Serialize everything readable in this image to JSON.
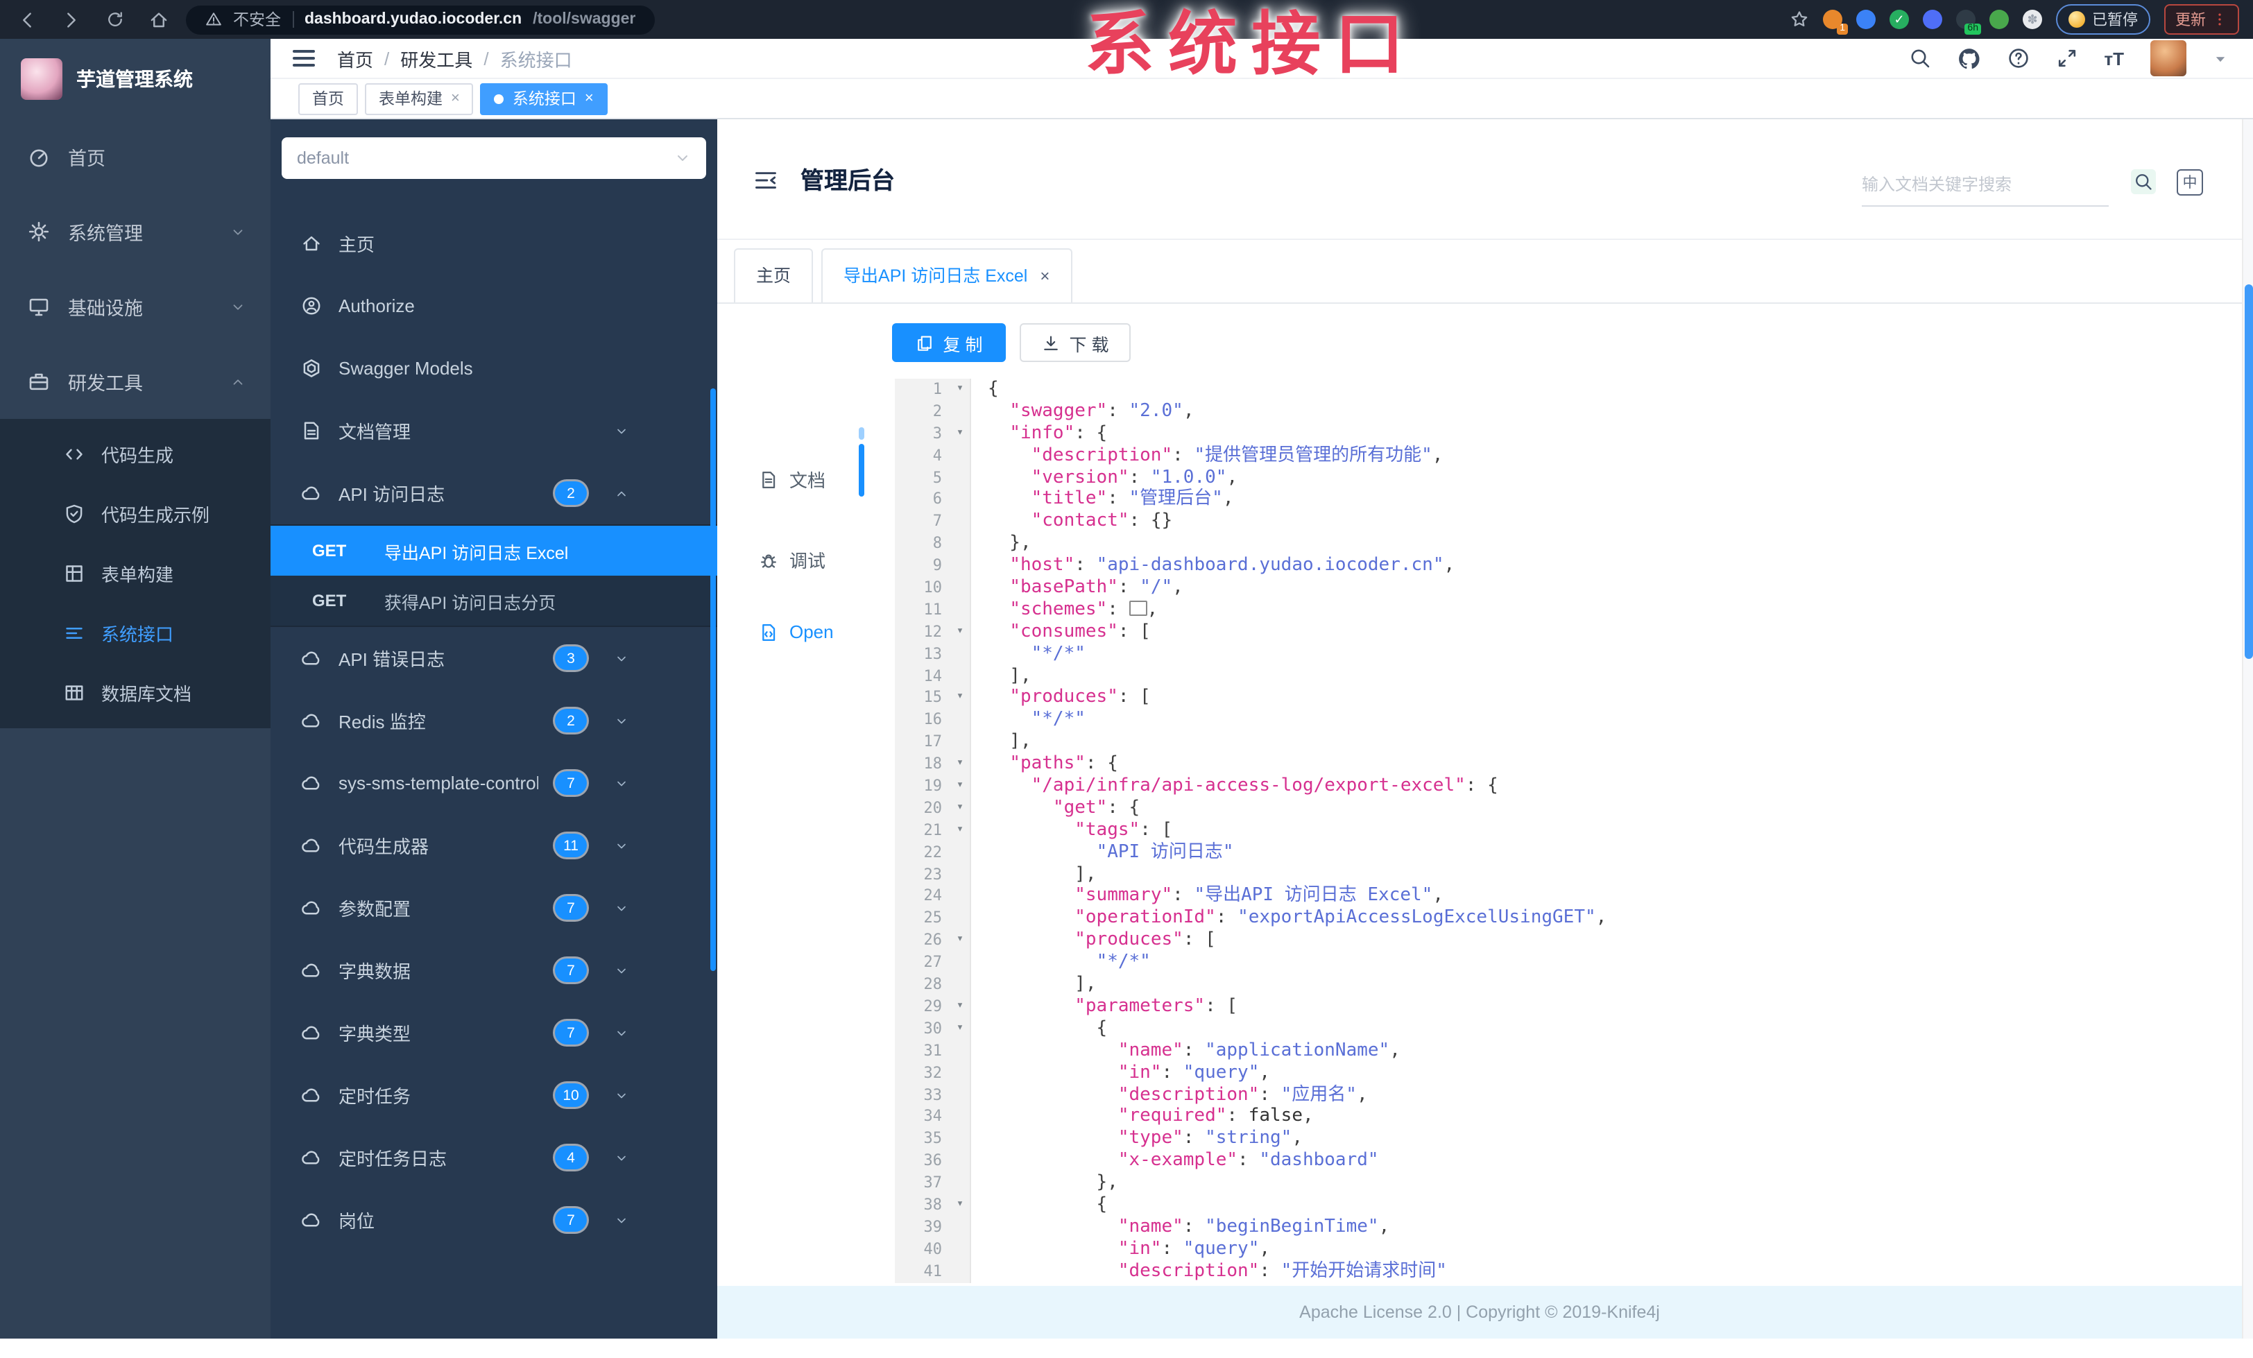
{
  "watermark": {
    "text": "系统接口"
  },
  "browser": {
    "security_label": "不安全",
    "url_host": "dashboard.yudao.iocoder.cn",
    "url_path": "/tool/swagger",
    "ext_badge_1": "1",
    "ext_badge_6h": "6h",
    "paused_label": "已暂停",
    "update_label": "更新"
  },
  "sidebar": {
    "title": "芋道管理系统",
    "menu": [
      {
        "name": "home",
        "icon": "gauge",
        "label": "首页"
      },
      {
        "name": "system-mgmt",
        "icon": "gear",
        "label": "系统管理",
        "chevron": "down"
      },
      {
        "name": "infrastructure",
        "icon": "monitor",
        "label": "基础设施",
        "chevron": "down"
      },
      {
        "name": "dev-tools",
        "icon": "briefcase",
        "label": "研发工具",
        "chevron": "up"
      }
    ],
    "submenu": [
      {
        "name": "code-gen",
        "icon": "code",
        "label": "代码生成"
      },
      {
        "name": "code-gen-example",
        "icon": "shield",
        "label": "代码生成示例"
      },
      {
        "name": "form-builder",
        "icon": "grid",
        "label": "表单构建"
      },
      {
        "name": "system-api",
        "icon": "api",
        "label": "系统接口",
        "active": true
      },
      {
        "name": "db-doc",
        "icon": "table",
        "label": "数据库文档"
      }
    ]
  },
  "breadcrumb": {
    "items": [
      "首页",
      "研发工具",
      "系统接口"
    ]
  },
  "tags": [
    {
      "label": "首页"
    },
    {
      "label": "表单构建"
    },
    {
      "label": "系统接口"
    }
  ],
  "k4": {
    "select_value": "default",
    "items": [
      {
        "name": "k4-home",
        "icon": "home",
        "label": "主页"
      },
      {
        "name": "authorize",
        "icon": "auth",
        "label": "Authorize"
      },
      {
        "name": "swagger-models",
        "icon": "models",
        "label": "Swagger Models"
      },
      {
        "name": "doc-mgmt",
        "icon": "doc",
        "label": "文档管理",
        "chevron": "down"
      },
      {
        "name": "api-access-log",
        "icon": "cloud",
        "label": "API 访问日志",
        "badge": "2",
        "chevron": "up"
      },
      {
        "name": "get-export-excel",
        "type": "get",
        "method": "GET",
        "label": "导出API 访问日志 Excel",
        "active": true
      },
      {
        "name": "get-access-log-page",
        "type": "get",
        "method": "GET",
        "label": "获得API 访问日志分页"
      },
      {
        "name": "api-error-log",
        "icon": "cloud",
        "label": "API 错误日志",
        "badge": "3",
        "chevron": "down"
      },
      {
        "name": "redis-monitor",
        "icon": "cloud",
        "label": "Redis 监控",
        "badge": "2",
        "chevron": "down"
      },
      {
        "name": "sms-template-controller",
        "icon": "cloud",
        "label": "sys-sms-template-controller",
        "badge": "7",
        "chevron": "down"
      },
      {
        "name": "code-generator",
        "icon": "cloud",
        "label": "代码生成器",
        "badge": "11",
        "chevron": "down"
      },
      {
        "name": "param-config",
        "icon": "cloud",
        "label": "参数配置",
        "badge": "7",
        "chevron": "down"
      },
      {
        "name": "dict-data",
        "icon": "cloud",
        "label": "字典数据",
        "badge": "7",
        "chevron": "down"
      },
      {
        "name": "dict-type",
        "icon": "cloud",
        "label": "字典类型",
        "badge": "7",
        "chevron": "down"
      },
      {
        "name": "scheduled-job",
        "icon": "cloud",
        "label": "定时任务",
        "badge": "10",
        "chevron": "down"
      },
      {
        "name": "scheduled-job-log",
        "icon": "cloud",
        "label": "定时任务日志",
        "badge": "4",
        "chevron": "down"
      },
      {
        "name": "post",
        "icon": "cloud",
        "label": "岗位",
        "badge": "7",
        "chevron": "down"
      }
    ]
  },
  "main": {
    "title": "管理后台",
    "search_placeholder": "输入文档关键字搜索",
    "lang_badge": "中",
    "tab_home": "主页",
    "tab_active": "导出API 访问日志 Excel",
    "copy_label": "复 制",
    "download_label": "下 载",
    "rail": [
      {
        "label": "文档",
        "icon": "file"
      },
      {
        "label": "调试",
        "icon": "bug"
      },
      {
        "label": "Open",
        "icon": "filecode",
        "active": true
      }
    ]
  },
  "editor": {
    "lines": [
      {
        "n": 1,
        "f": 1,
        "s": [
          [
            "p",
            "{"
          ]
        ]
      },
      {
        "n": 2,
        "s": [
          [
            "p",
            "  "
          ],
          [
            "k",
            "\"swagger\""
          ],
          [
            "p",
            ": "
          ],
          [
            "v",
            "\"2.0\""
          ],
          [
            "p",
            ","
          ]
        ]
      },
      {
        "n": 3,
        "f": 1,
        "s": [
          [
            "p",
            "  "
          ],
          [
            "k",
            "\"info\""
          ],
          [
            "p",
            ": {"
          ]
        ]
      },
      {
        "n": 4,
        "s": [
          [
            "p",
            "    "
          ],
          [
            "k",
            "\"description\""
          ],
          [
            "p",
            ": "
          ],
          [
            "v",
            "\"提供管理员管理的所有功能\""
          ],
          [
            "p",
            ","
          ]
        ]
      },
      {
        "n": 5,
        "s": [
          [
            "p",
            "    "
          ],
          [
            "k",
            "\"version\""
          ],
          [
            "p",
            ": "
          ],
          [
            "v",
            "\"1.0.0\""
          ],
          [
            "p",
            ","
          ]
        ]
      },
      {
        "n": 6,
        "s": [
          [
            "p",
            "    "
          ],
          [
            "k",
            "\"title\""
          ],
          [
            "p",
            ": "
          ],
          [
            "v",
            "\"管理后台\""
          ],
          [
            "p",
            ","
          ]
        ]
      },
      {
        "n": 7,
        "s": [
          [
            "p",
            "    "
          ],
          [
            "k",
            "\"contact\""
          ],
          [
            "p",
            ": {}"
          ]
        ]
      },
      {
        "n": 8,
        "s": [
          [
            "p",
            "  },"
          ]
        ]
      },
      {
        "n": 9,
        "s": [
          [
            "p",
            "  "
          ],
          [
            "k",
            "\"host\""
          ],
          [
            "p",
            ": "
          ],
          [
            "v",
            "\"api-dashboard.yudao.iocoder.cn\""
          ],
          [
            "p",
            ","
          ]
        ]
      },
      {
        "n": 10,
        "s": [
          [
            "p",
            "  "
          ],
          [
            "k",
            "\"basePath\""
          ],
          [
            "p",
            ": "
          ],
          [
            "v",
            "\"/\""
          ],
          [
            "p",
            ","
          ]
        ]
      },
      {
        "n": 11,
        "s": [
          [
            "p",
            "  "
          ],
          [
            "k",
            "\"schemes\""
          ],
          [
            "p",
            ": "
          ],
          [
            "x",
            ""
          ],
          [
            "p",
            ","
          ]
        ]
      },
      {
        "n": 12,
        "f": 1,
        "s": [
          [
            "p",
            "  "
          ],
          [
            "k",
            "\"consumes\""
          ],
          [
            "p",
            ": ["
          ]
        ]
      },
      {
        "n": 13,
        "s": [
          [
            "p",
            "    "
          ],
          [
            "v",
            "\"*/*\""
          ]
        ]
      },
      {
        "n": 14,
        "s": [
          [
            "p",
            "  ],"
          ]
        ]
      },
      {
        "n": 15,
        "f": 1,
        "s": [
          [
            "p",
            "  "
          ],
          [
            "k",
            "\"produces\""
          ],
          [
            "p",
            ": ["
          ]
        ]
      },
      {
        "n": 16,
        "s": [
          [
            "p",
            "    "
          ],
          [
            "v",
            "\"*/*\""
          ]
        ]
      },
      {
        "n": 17,
        "s": [
          [
            "p",
            "  ],"
          ]
        ]
      },
      {
        "n": 18,
        "f": 1,
        "s": [
          [
            "p",
            "  "
          ],
          [
            "k",
            "\"paths\""
          ],
          [
            "p",
            ": {"
          ]
        ]
      },
      {
        "n": 19,
        "f": 1,
        "s": [
          [
            "p",
            "    "
          ],
          [
            "k",
            "\"/api/infra/api-access-log/export-excel\""
          ],
          [
            "p",
            ": {"
          ]
        ]
      },
      {
        "n": 20,
        "f": 1,
        "s": [
          [
            "p",
            "      "
          ],
          [
            "k",
            "\"get\""
          ],
          [
            "p",
            ": {"
          ]
        ]
      },
      {
        "n": 21,
        "f": 1,
        "s": [
          [
            "p",
            "        "
          ],
          [
            "k",
            "\"tags\""
          ],
          [
            "p",
            ": ["
          ]
        ]
      },
      {
        "n": 22,
        "s": [
          [
            "p",
            "          "
          ],
          [
            "v",
            "\"API 访问日志\""
          ]
        ]
      },
      {
        "n": 23,
        "s": [
          [
            "p",
            "        ],"
          ]
        ]
      },
      {
        "n": 24,
        "s": [
          [
            "p",
            "        "
          ],
          [
            "k",
            "\"summary\""
          ],
          [
            "p",
            ": "
          ],
          [
            "v",
            "\"导出API 访问日志 Excel\""
          ],
          [
            "p",
            ","
          ]
        ]
      },
      {
        "n": 25,
        "s": [
          [
            "p",
            "        "
          ],
          [
            "k",
            "\"operationId\""
          ],
          [
            "p",
            ": "
          ],
          [
            "v",
            "\"exportApiAccessLogExcelUsingGET\""
          ],
          [
            "p",
            ","
          ]
        ]
      },
      {
        "n": 26,
        "f": 1,
        "s": [
          [
            "p",
            "        "
          ],
          [
            "k",
            "\"produces\""
          ],
          [
            "p",
            ": ["
          ]
        ]
      },
      {
        "n": 27,
        "s": [
          [
            "p",
            "          "
          ],
          [
            "v",
            "\"*/*\""
          ]
        ]
      },
      {
        "n": 28,
        "s": [
          [
            "p",
            "        ],"
          ]
        ]
      },
      {
        "n": 29,
        "f": 1,
        "s": [
          [
            "p",
            "        "
          ],
          [
            "k",
            "\"parameters\""
          ],
          [
            "p",
            ": ["
          ]
        ]
      },
      {
        "n": 30,
        "f": 1,
        "s": [
          [
            "p",
            "          {"
          ]
        ]
      },
      {
        "n": 31,
        "s": [
          [
            "p",
            "            "
          ],
          [
            "k",
            "\"name\""
          ],
          [
            "p",
            ": "
          ],
          [
            "v",
            "\"applicationName\""
          ],
          [
            "p",
            ","
          ]
        ]
      },
      {
        "n": 32,
        "s": [
          [
            "p",
            "            "
          ],
          [
            "k",
            "\"in\""
          ],
          [
            "p",
            ": "
          ],
          [
            "v",
            "\"query\""
          ],
          [
            "p",
            ","
          ]
        ]
      },
      {
        "n": 33,
        "s": [
          [
            "p",
            "            "
          ],
          [
            "k",
            "\"description\""
          ],
          [
            "p",
            ": "
          ],
          [
            "v",
            "\"应用名\""
          ],
          [
            "p",
            ","
          ]
        ]
      },
      {
        "n": 34,
        "s": [
          [
            "p",
            "            "
          ],
          [
            "k",
            "\"required\""
          ],
          [
            "p",
            ": "
          ],
          [
            "b",
            "false"
          ],
          [
            "p",
            ","
          ]
        ]
      },
      {
        "n": 35,
        "s": [
          [
            "p",
            "            "
          ],
          [
            "k",
            "\"type\""
          ],
          [
            "p",
            ": "
          ],
          [
            "v",
            "\"string\""
          ],
          [
            "p",
            ","
          ]
        ]
      },
      {
        "n": 36,
        "s": [
          [
            "p",
            "            "
          ],
          [
            "k",
            "\"x-example\""
          ],
          [
            "p",
            ": "
          ],
          [
            "v",
            "\"dashboard\""
          ]
        ]
      },
      {
        "n": 37,
        "s": [
          [
            "p",
            "          },"
          ]
        ]
      },
      {
        "n": 38,
        "f": 1,
        "s": [
          [
            "p",
            "          {"
          ]
        ]
      },
      {
        "n": 39,
        "s": [
          [
            "p",
            "            "
          ],
          [
            "k",
            "\"name\""
          ],
          [
            "p",
            ": "
          ],
          [
            "v",
            "\"beginBeginTime\""
          ],
          [
            "p",
            ","
          ]
        ]
      },
      {
        "n": 40,
        "s": [
          [
            "p",
            "            "
          ],
          [
            "k",
            "\"in\""
          ],
          [
            "p",
            ": "
          ],
          [
            "v",
            "\"query\""
          ],
          [
            "p",
            ","
          ]
        ]
      },
      {
        "n": 41,
        "s": [
          [
            "p",
            "            "
          ],
          [
            "k",
            "\"description\""
          ],
          [
            "p",
            ": "
          ],
          [
            "v",
            "\"开始开始请求时间\""
          ]
        ]
      }
    ]
  },
  "footer": {
    "text": "Apache License 2.0 | Copyright © 2019-Knife4j"
  }
}
